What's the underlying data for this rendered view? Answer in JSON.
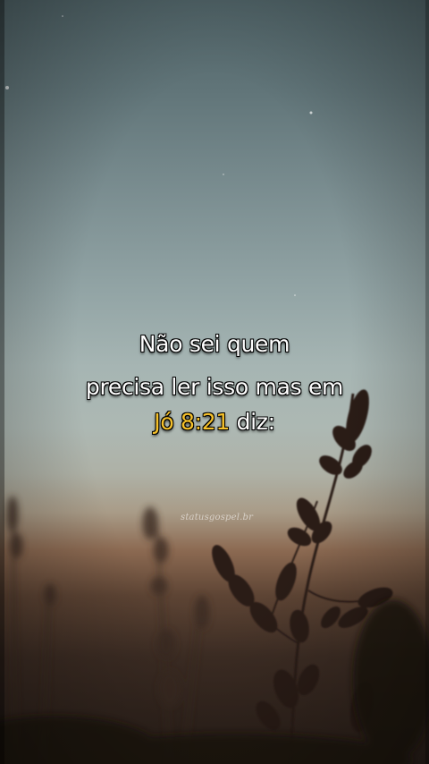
{
  "caption": {
    "line1": "Não sei quem",
    "line2": "precisa ler isso mas em",
    "line3_reference": "Jó 8:21",
    "line3_rest": " diz:"
  },
  "watermark": "statusgospel.br",
  "colors": {
    "text": "#ffffff",
    "reference_highlight": "#f6c12a",
    "sky_top": "#4f6266",
    "horizon_glow": "#a99c88",
    "ground": "#2a1f19"
  }
}
